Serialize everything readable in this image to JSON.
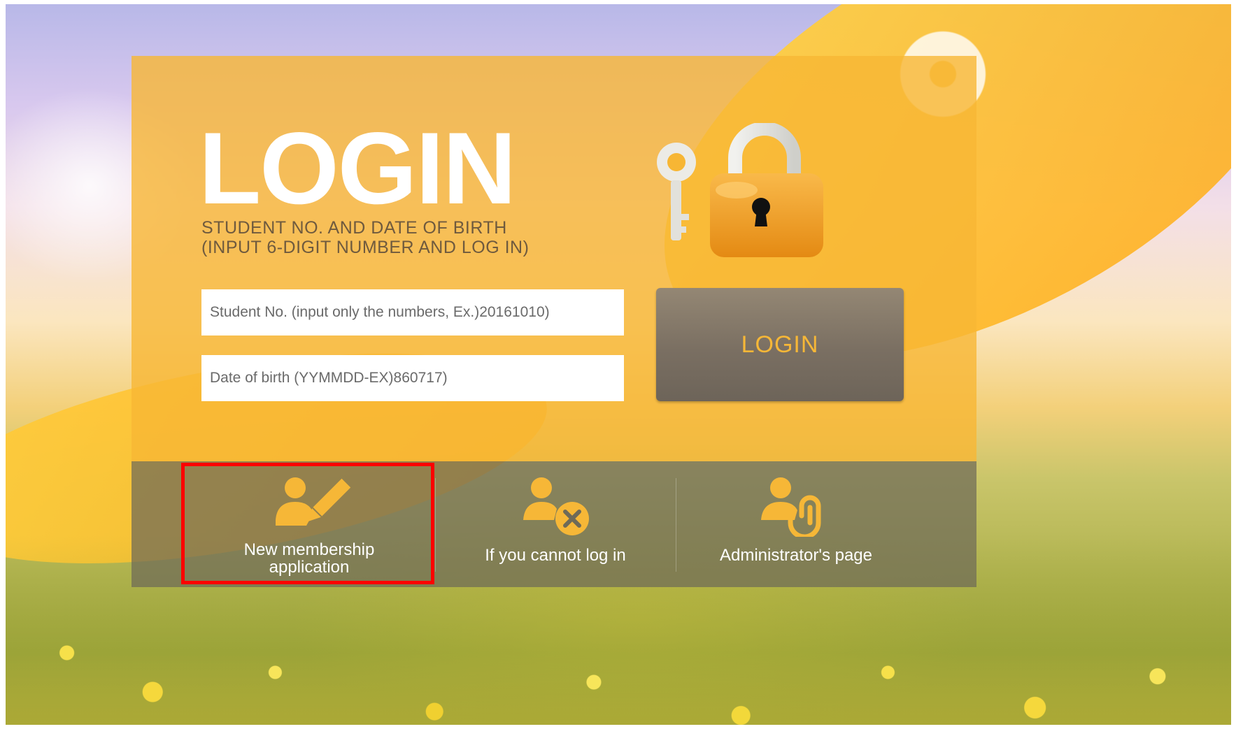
{
  "login": {
    "heading": "LOGIN",
    "instructions_line1": "STUDENT NO. AND DATE OF BIRTH",
    "instructions_line2": "(INPUT 6-DIGIT NUMBER AND LOG IN)",
    "student_no_placeholder": "Student No. (input only the numbers, Ex.)20161010)",
    "birth_placeholder": "Date of birth (YYMMDD-EX)860717)",
    "button_label": "LOGIN"
  },
  "actions": [
    {
      "label_line1": "New membership",
      "label_line2": "application",
      "icon": "person-pencil-icon"
    },
    {
      "label": "If you cannot log in",
      "icon": "person-x-icon"
    },
    {
      "label": "Administrator's page",
      "icon": "person-paperclip-icon"
    }
  ],
  "colors": {
    "panel": "#f7b634",
    "accent": "#f6b737",
    "login_button": "#7a6f62",
    "action_bar": "#6e6a58",
    "highlight": "#ff0000"
  }
}
